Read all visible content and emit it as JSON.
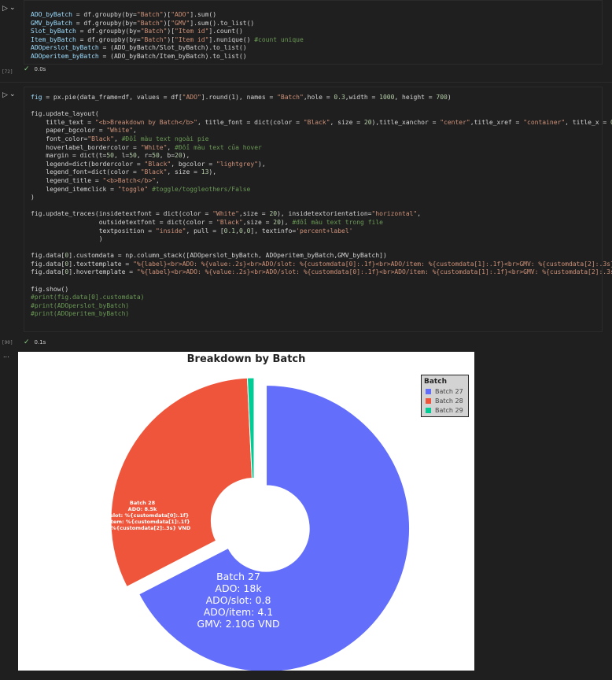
{
  "cells": [
    {
      "exec_count": "[72]",
      "status_time": "0.0s",
      "lines": [
        [
          [
            "var",
            "ADO_byBatch"
          ],
          [
            "plain",
            " = df.groupby(by="
          ],
          [
            "str",
            "\"Batch\""
          ],
          [
            "plain",
            ")["
          ],
          [
            "str",
            "\"ADO\""
          ],
          [
            "plain",
            "].sum()"
          ]
        ],
        [
          [
            "var",
            "GMV_byBatch"
          ],
          [
            "plain",
            " = df.groupby(by="
          ],
          [
            "str",
            "\"Batch\""
          ],
          [
            "plain",
            ")["
          ],
          [
            "str",
            "\"GMV\""
          ],
          [
            "plain",
            "].sum().to_list()"
          ]
        ],
        [
          [
            "var",
            "Slot_byBatch"
          ],
          [
            "plain",
            " = df.groupby(by="
          ],
          [
            "str",
            "\"Batch\""
          ],
          [
            "plain",
            ")["
          ],
          [
            "str",
            "\"Item id\""
          ],
          [
            "plain",
            "].count()"
          ]
        ],
        [
          [
            "var",
            "Item_byBatch"
          ],
          [
            "plain",
            " = df.groupby(by="
          ],
          [
            "str",
            "\"Batch\""
          ],
          [
            "plain",
            ")["
          ],
          [
            "str",
            "\"Item id\""
          ],
          [
            "plain",
            "].nunique() "
          ],
          [
            "cm",
            "#count unique"
          ]
        ],
        [
          [
            "var",
            "ADOperslot_byBatch"
          ],
          [
            "plain",
            " = (ADO_byBatch/Slot_byBatch).to_list()"
          ]
        ],
        [
          [
            "var",
            "ADOperitem_byBatch"
          ],
          [
            "plain",
            " = (ADO_byBatch/Item_byBatch).to_list()"
          ]
        ]
      ]
    },
    {
      "exec_count": "[90]",
      "status_time": "0.1s",
      "lines": [
        [
          [
            "var",
            "fig"
          ],
          [
            "plain",
            " = px.pie(data_frame=df, values = df["
          ],
          [
            "str",
            "\"ADO\""
          ],
          [
            "plain",
            "].round(1), names = "
          ],
          [
            "str",
            "\"Batch\""
          ],
          [
            "plain",
            ",hole = "
          ],
          [
            "num",
            "0.3"
          ],
          [
            "plain",
            ",width = "
          ],
          [
            "num",
            "1000"
          ],
          [
            "plain",
            ", height = "
          ],
          [
            "num",
            "700"
          ],
          [
            "plain",
            ")"
          ]
        ],
        [
          [
            "plain",
            ""
          ]
        ],
        [
          [
            "plain",
            "fig.update_layout("
          ]
        ],
        [
          [
            "plain",
            "    title_text = "
          ],
          [
            "str",
            "\"<b>Breakdown by Batch</b>\""
          ],
          [
            "plain",
            ", title_font = dict(color = "
          ],
          [
            "str",
            "\"Black\""
          ],
          [
            "plain",
            ", size = "
          ],
          [
            "num",
            "20"
          ],
          [
            "plain",
            "),title_xanchor = "
          ],
          [
            "str",
            "\"center\""
          ],
          [
            "plain",
            ",title_xref = "
          ],
          [
            "str",
            "\"container\""
          ],
          [
            "plain",
            ", title_x = "
          ],
          [
            "num",
            "0.5"
          ],
          [
            "plain",
            ","
          ]
        ],
        [
          [
            "plain",
            "    paper_bgcolor = "
          ],
          [
            "str",
            "\"White\""
          ],
          [
            "plain",
            ","
          ]
        ],
        [
          [
            "plain",
            "    font_color="
          ],
          [
            "str",
            "\"Black\""
          ],
          [
            "plain",
            ", "
          ],
          [
            "cm",
            "#Đổi màu text ngoài pie"
          ]
        ],
        [
          [
            "plain",
            "    hoverlabel_bordercolor = "
          ],
          [
            "str",
            "\"White\""
          ],
          [
            "plain",
            ", "
          ],
          [
            "cm",
            "#Đổi màu text của hover"
          ]
        ],
        [
          [
            "plain",
            "    margin = dict(t="
          ],
          [
            "num",
            "50"
          ],
          [
            "plain",
            ", l="
          ],
          [
            "num",
            "50"
          ],
          [
            "plain",
            ", r="
          ],
          [
            "num",
            "50"
          ],
          [
            "plain",
            ", b="
          ],
          [
            "num",
            "20"
          ],
          [
            "plain",
            "),"
          ]
        ],
        [
          [
            "plain",
            "    legend=dict(bordercolor = "
          ],
          [
            "str",
            "\"Black\""
          ],
          [
            "plain",
            ", bgcolor = "
          ],
          [
            "str",
            "\"lightgrey\""
          ],
          [
            "plain",
            "),"
          ]
        ],
        [
          [
            "plain",
            "    legend_font=dict(color = "
          ],
          [
            "str",
            "\"Black\""
          ],
          [
            "plain",
            ", size = "
          ],
          [
            "num",
            "13"
          ],
          [
            "plain",
            "),"
          ]
        ],
        [
          [
            "plain",
            "    legend_title = "
          ],
          [
            "str",
            "\"<b>Batch</b>\""
          ],
          [
            "plain",
            ","
          ]
        ],
        [
          [
            "plain",
            "    legend_itemclick = "
          ],
          [
            "str",
            "\"toggle\""
          ],
          [
            "plain",
            " "
          ],
          [
            "cm",
            "#toggle/toggleothers/False"
          ]
        ],
        [
          [
            "plain",
            ")"
          ]
        ],
        [
          [
            "plain",
            ""
          ]
        ],
        [
          [
            "plain",
            "fig.update_traces(insidetextfont = dict(color = "
          ],
          [
            "str",
            "\"White\""
          ],
          [
            "plain",
            ",size = "
          ],
          [
            "num",
            "20"
          ],
          [
            "plain",
            "), insidetextorientation="
          ],
          [
            "str",
            "\"horizontal\""
          ],
          [
            "plain",
            ","
          ]
        ],
        [
          [
            "plain",
            "                  outsidetextfont = dict(color = "
          ],
          [
            "str",
            "\"Black\""
          ],
          [
            "plain",
            ",size = "
          ],
          [
            "num",
            "20"
          ],
          [
            "plain",
            "), "
          ],
          [
            "cm",
            "#đổi màu text trong file"
          ]
        ],
        [
          [
            "plain",
            "                  textposition = "
          ],
          [
            "str",
            "\"inside\""
          ],
          [
            "plain",
            ", pull = ["
          ],
          [
            "num",
            "0.1"
          ],
          [
            "plain",
            ","
          ],
          [
            "num",
            "0"
          ],
          [
            "plain",
            ","
          ],
          [
            "num",
            "0"
          ],
          [
            "plain",
            "], textinfo="
          ],
          [
            "str",
            "'percent+label'"
          ]
        ],
        [
          [
            "plain",
            "                  )"
          ]
        ],
        [
          [
            "plain",
            ""
          ]
        ],
        [
          [
            "plain",
            "fig.data["
          ],
          [
            "num",
            "0"
          ],
          [
            "plain",
            "].customdata = np.column_stack([ADOperslot_byBatch, ADOperitem_byBatch,GMV_byBatch])"
          ]
        ],
        [
          [
            "plain",
            "fig.data["
          ],
          [
            "num",
            "0"
          ],
          [
            "plain",
            "].texttemplate = "
          ],
          [
            "str",
            "\"%{label}<br>ADO: %{value:.2s}<br>ADO/slot: %{customdata[0]:.1f}<br>ADO/item: %{customdata[1]:.1f}<br>GMV: %{customdata[2]:.3s} VND\""
          ]
        ],
        [
          [
            "plain",
            "fig.data["
          ],
          [
            "num",
            "0"
          ],
          [
            "plain",
            "].hovertemplate = "
          ],
          [
            "str",
            "\"%{label}<br>ADO: %{value:.2s}<br>ADO/slot: %{customdata[0]:.1f}<br>ADO/item: %{customdata[1]:.1f}<br>GMV: %{customdata[2]:.3s} VND\""
          ]
        ],
        [
          [
            "plain",
            ""
          ]
        ],
        [
          [
            "plain",
            "fig.show()"
          ]
        ],
        [
          [
            "cm",
            "#print(fig.data[0].customdata)"
          ]
        ],
        [
          [
            "cm",
            "#print(ADOperslot_byBatch)"
          ]
        ],
        [
          [
            "cm",
            "#print(ADOperitem_byBatch)"
          ]
        ]
      ]
    }
  ],
  "output_ellipsis": "...",
  "chart_data": {
    "type": "pie",
    "title": "Breakdown by Batch",
    "hole": 0.3,
    "legend_title": "Batch",
    "legend_position": "top-right",
    "categories": [
      "Batch 27",
      "Batch 28",
      "Batch 29"
    ],
    "values": [
      18000,
      8500,
      200
    ],
    "pull": [
      0.1,
      0,
      0
    ],
    "colors": [
      "#636efa",
      "#ef553b",
      "#00cc96"
    ],
    "labels": [
      [
        "Batch 27",
        "ADO: 18k",
        "ADO/slot: 0.8",
        "ADO/item: 4.1",
        "GMV: 2.10G VND"
      ],
      [
        "Batch 28",
        "ADO: 8.5k",
        "ADO/slot: %{customdata[0]:.1f}",
        "ADO/item: %{customdata[1]:.1f}",
        "GMV: %{customdata[2]:.3s} VND"
      ],
      []
    ]
  }
}
